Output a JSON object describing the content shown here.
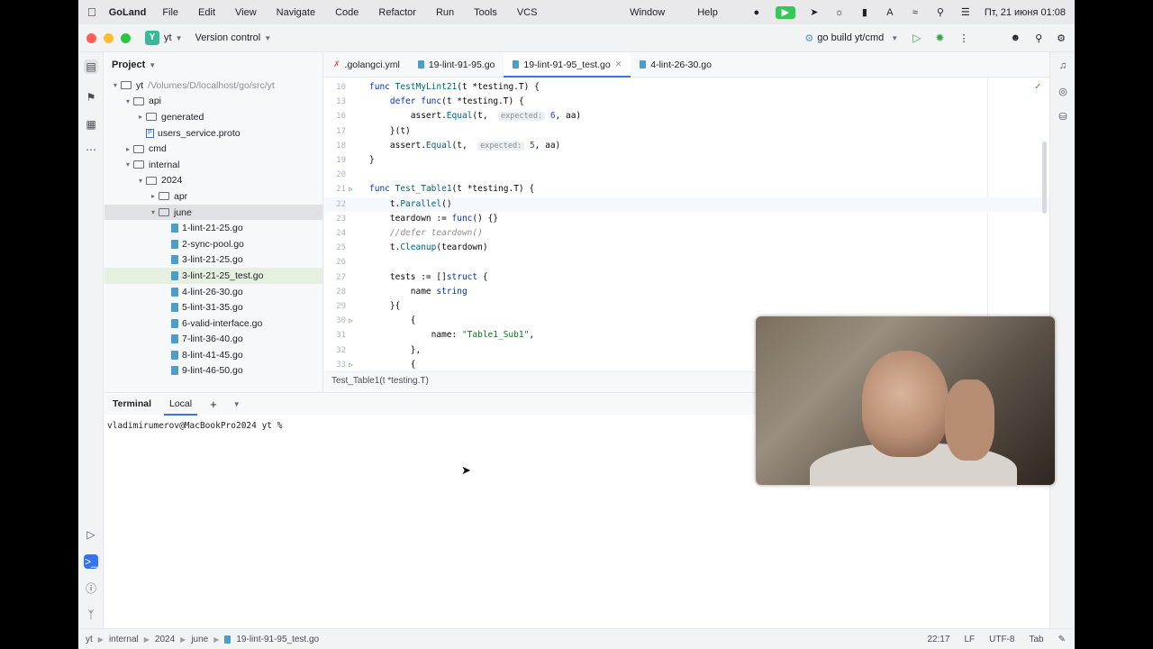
{
  "menubar": {
    "app": "GoLand",
    "items": [
      "File",
      "Edit",
      "View",
      "Navigate",
      "Code",
      "Refactor",
      "Run",
      "Tools",
      "VCS"
    ],
    "right_items": [
      "Window",
      "Help"
    ],
    "datetime": "Пт, 21 июня 01:08"
  },
  "titlebar": {
    "project_badge": "Y",
    "project_name": "yt",
    "version_control": "Version control",
    "run_config": "go build yt/cmd"
  },
  "project_panel": {
    "title": "Project",
    "tree": [
      {
        "label": "yt",
        "path": "/Volumes/D/localhost/go/src/yt",
        "type": "folder",
        "depth": 0,
        "expanded": true
      },
      {
        "label": "api",
        "type": "folder",
        "depth": 1,
        "expanded": true
      },
      {
        "label": "generated",
        "type": "folder",
        "depth": 2,
        "expanded": false
      },
      {
        "label": "users_service.proto",
        "type": "proto",
        "depth": 2
      },
      {
        "label": "cmd",
        "type": "folder",
        "depth": 1,
        "expanded": false
      },
      {
        "label": "internal",
        "type": "folder",
        "depth": 1,
        "expanded": true
      },
      {
        "label": "2024",
        "type": "folder",
        "depth": 2,
        "expanded": true
      },
      {
        "label": "apr",
        "type": "folder",
        "depth": 3,
        "expanded": false
      },
      {
        "label": "june",
        "type": "folder",
        "depth": 3,
        "expanded": true,
        "selected": true
      },
      {
        "label": "1-lint-21-25.go",
        "type": "go",
        "depth": 4
      },
      {
        "label": "2-sync-pool.go",
        "type": "go",
        "depth": 4
      },
      {
        "label": "3-lint-21-25.go",
        "type": "go",
        "depth": 4
      },
      {
        "label": "3-lint-21-25_test.go",
        "type": "go",
        "depth": 4,
        "highlight": true
      },
      {
        "label": "4-lint-26-30.go",
        "type": "go",
        "depth": 4
      },
      {
        "label": "5-lint-31-35.go",
        "type": "go",
        "depth": 4
      },
      {
        "label": "6-valid-interface.go",
        "type": "go",
        "depth": 4
      },
      {
        "label": "7-lint-36-40.go",
        "type": "go",
        "depth": 4
      },
      {
        "label": "8-lint-41-45.go",
        "type": "go",
        "depth": 4
      },
      {
        "label": "9-lint-46-50.go",
        "type": "go",
        "depth": 4
      }
    ]
  },
  "tabs": [
    {
      "label": ".golangci.yml",
      "icon": "yml-icon",
      "active": false
    },
    {
      "label": "19-lint-91-95.go",
      "icon": "go-file-icon",
      "active": false
    },
    {
      "label": "19-lint-91-95_test.go",
      "icon": "go-file-icon",
      "active": true
    },
    {
      "label": "4-lint-26-30.go",
      "icon": "go-file-icon",
      "active": false
    }
  ],
  "editor": {
    "lines": [
      {
        "n": "10",
        "html": "<span class='kw'>func</span> <span class='fn'>TestMyLint21</span>(t *testing.<span class='type'>T</span>) {"
      },
      {
        "n": "13",
        "html": "    <span class='kw'>defer</span> <span class='kw'>func</span>(t *testing.<span class='type'>T</span>) {"
      },
      {
        "n": "16",
        "html": "        assert.<span class='fn'>Equal</span>(t,  <span class='hint'>expected:</span> <span class='num'>6</span>, aa)"
      },
      {
        "n": "17",
        "html": "    }(t)"
      },
      {
        "n": "18",
        "html": "    assert.<span class='fn'>Equal</span>(t,  <span class='hint'>expected:</span> <span class='num'>5</span>, aa)"
      },
      {
        "n": "19",
        "html": "}"
      },
      {
        "n": "20",
        "html": ""
      },
      {
        "n": "21",
        "html": "<span class='kw'>func</span> <span class='fn'>Test_Table1</span>(t *testing.<span class='type'>T</span>) {",
        "run": true
      },
      {
        "n": "22",
        "html": "    t.<span class='fn'>Parallel</span>()",
        "current": true
      },
      {
        "n": "23",
        "html": "    teardown := <span class='kw'>func</span>() {}"
      },
      {
        "n": "24",
        "html": "    <span class='cm'>//defer teardown()</span>"
      },
      {
        "n": "25",
        "html": "    t.<span class='fn'>Cleanup</span>(teardown)"
      },
      {
        "n": "26",
        "html": ""
      },
      {
        "n": "27",
        "html": "    tests := []<span class='kw'>struct</span> {"
      },
      {
        "n": "28",
        "html": "        name <span class='kw'>string</span>"
      },
      {
        "n": "29",
        "html": "    }{"
      },
      {
        "n": "30",
        "html": "        {",
        "run": true
      },
      {
        "n": "31",
        "html": "            name: <span class='str'>\"Table1_Sub1\"</span>,"
      },
      {
        "n": "32",
        "html": "        },"
      },
      {
        "n": "33",
        "html": "        {",
        "run": true
      }
    ],
    "breadcrumb": "Test_Table1(t *testing.T)"
  },
  "terminal": {
    "title": "Terminal",
    "tab": "Local",
    "prompt": "vladimirumerov@MacBookPro2024 yt %"
  },
  "statusbar": {
    "crumbs": [
      "yt",
      "internal",
      "2024",
      "june",
      "19-lint-91-95_test.go"
    ],
    "position": "22:17",
    "line_sep": "LF",
    "encoding": "UTF-8",
    "indent": "Tab"
  }
}
